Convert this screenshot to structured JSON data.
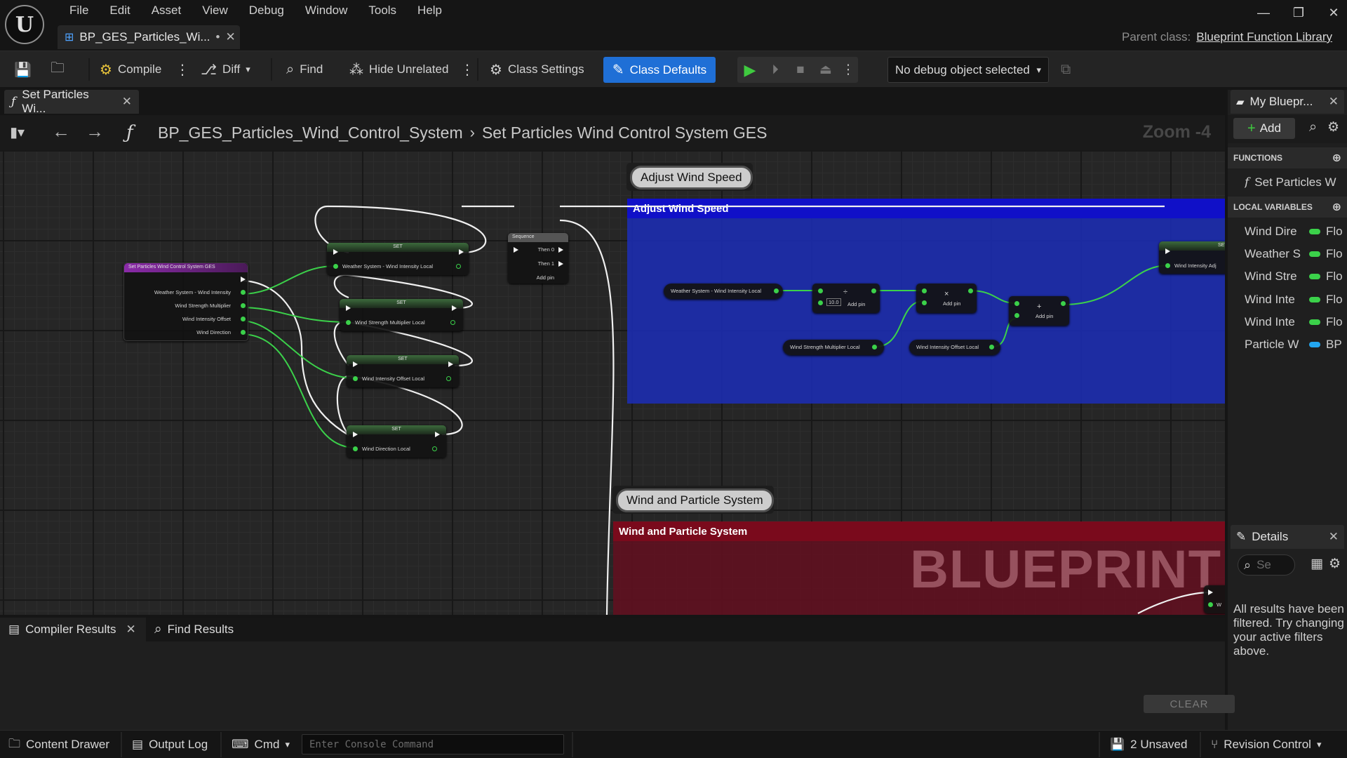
{
  "app": {
    "menu": [
      "File",
      "Edit",
      "Asset",
      "View",
      "Debug",
      "Window",
      "Tools",
      "Help"
    ],
    "doc_tab": "BP_GES_Particles_Wi...",
    "doc_tab_modified": "•",
    "parent_class_label": "Parent class:",
    "parent_class_value": "Blueprint Function Library"
  },
  "toolbar": {
    "compile": "Compile",
    "diff": "Diff",
    "find": "Find",
    "hide_unrelated": "Hide Unrelated",
    "class_settings": "Class Settings",
    "class_defaults": "Class Defaults",
    "debug_object": "No debug object selected"
  },
  "graph_tab": "Set Particles Wi...",
  "breadcrumb": {
    "blueprint": "BP_GES_Particles_Wind_Control_System",
    "function": "Set Particles Wind Control System GES"
  },
  "zoom": "Zoom -4",
  "comments": {
    "adjust_bubble": "Adjust Wind Speed",
    "adjust_title": "Adjust Wind Speed",
    "wind_bubble": "Wind and Particle System",
    "wind_title": "Wind and Particle System",
    "watermark": "BLUEPRINT"
  },
  "nodes": {
    "entry": {
      "title": "Set Particles Wind Control System GES",
      "pins": [
        "Weather System - Wind Intensity",
        "Wind Strength Multiplier",
        "Wind Intensity Offset",
        "Wind Direction"
      ]
    },
    "set_label": "SET",
    "set_vars": [
      "Weather System - Wind Intensity Local",
      "Wind Strength Multiplier Local",
      "Wind Intensity Offset Local",
      "Wind Direction Local"
    ],
    "sequence": {
      "title": "Sequence",
      "pins": [
        "Then 0",
        "Then 1"
      ],
      "add_pin": "Add pin"
    },
    "getters": [
      "Weather System - Wind Intensity Local",
      "Wind Strength Multiplier Local",
      "Wind Intensity Offset Local"
    ],
    "math": {
      "divide_symbol": "÷",
      "divide_value": "10.0",
      "multiply_symbol": "×",
      "add_symbol": "+",
      "add_pin": "Add pin"
    },
    "right_set": {
      "label": "SET",
      "var": "Wind Intensity Adj"
    },
    "right_bottom_var": "W"
  },
  "my_blueprint": {
    "tab": "My Bluepr...",
    "add": "Add",
    "functions_header": "FUNCTIONS",
    "functions": [
      "Set Particles W"
    ],
    "locals_header": "LOCAL VARIABLES",
    "variables": [
      {
        "name": "Wind Dire",
        "type": "Flo",
        "color": "#3bd14a"
      },
      {
        "name": "Weather S",
        "type": "Flo",
        "color": "#3bd14a"
      },
      {
        "name": "Wind Stre",
        "type": "Flo",
        "color": "#3bd14a"
      },
      {
        "name": "Wind Inte",
        "type": "Flo",
        "color": "#3bd14a"
      },
      {
        "name": "Wind Inte",
        "type": "Flo",
        "color": "#3bd14a"
      },
      {
        "name": "Particle W",
        "type": "BP",
        "color": "#23a6f0"
      }
    ]
  },
  "details": {
    "tab": "Details",
    "search_placeholder": "Se",
    "message": "All results have been filtered. Try changing your active filters above."
  },
  "bottom": {
    "tab_compiler": "Compiler Results",
    "tab_find": "Find Results",
    "clear": "CLEAR"
  },
  "status": {
    "content_drawer": "Content Drawer",
    "output_log": "Output Log",
    "cmd": "Cmd",
    "console_placeholder": "Enter Console Command",
    "unsaved": "2 Unsaved",
    "revision_control": "Revision Control"
  },
  "colors": {
    "accent": "#1f6fd6",
    "adjust_comment": "#1f2fa8",
    "wind_comment": "#6b0b1c",
    "float_pin": "#3bd14a",
    "object_pin": "#23a6f0"
  }
}
